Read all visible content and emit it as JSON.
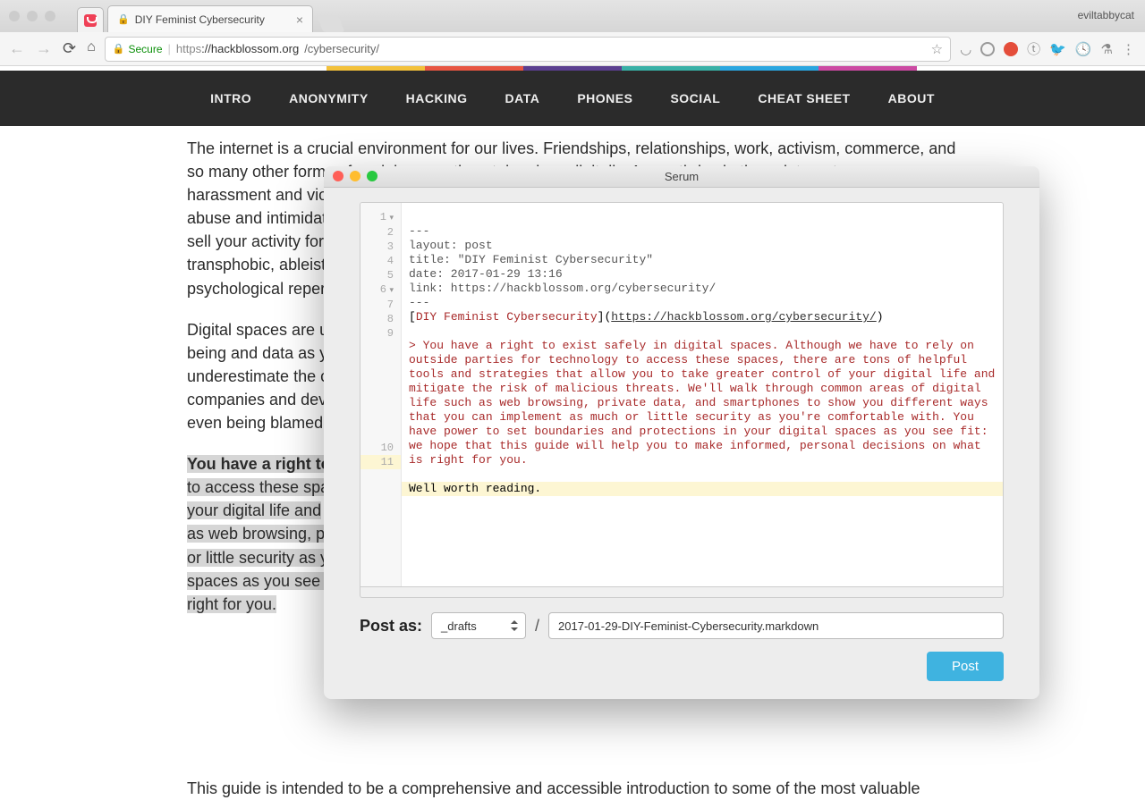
{
  "browser": {
    "profile": "eviltabbycat",
    "tab_title": "DIY Feminist Cybersecurity",
    "secure_label": "Secure",
    "url_scheme": "https",
    "url_host": "://hackblossom.org",
    "url_path": "/cybersecurity/"
  },
  "nav": {
    "items": [
      "INTRO",
      "ANONYMITY",
      "HACKING",
      "DATA",
      "PHONES",
      "SOCIAL",
      "CHEAT SHEET",
      "ABOUT"
    ]
  },
  "page": {
    "p1": "The internet is a crucial environment for our lives. Friendships, relationships, work, activism, commerce, and so many other forms of social connections take place digitally. As we thrive in these internet spaces, harassment and violence along",
    "p1b": "abuse and intimidat",
    "p1c": "sell your activity for",
    "p1d": "transphobic, ableist",
    "p1e": "psychological reper",
    "p2": "Digital spaces are u",
    "p2b": "being and data as y",
    "p2c": "underestimate the c",
    "p2d": "companies and dev",
    "p2e": "even being blamed",
    "p3_lead": "You have a right to",
    "p3a": "to access these spa",
    "p3b": "your digital life and",
    "p3c": "as web browsing, pr",
    "p3d": "or little security as y",
    "p3e": "spaces as you see f",
    "p3f": "right for you.",
    "p4": "This guide is intended to be a comprehensive and accessible introduction to some of the most valuable"
  },
  "editor": {
    "title": "Serum",
    "post_as_label": "Post as:",
    "folder_selected": "_drafts",
    "filename": "2017-01-29-DIY-Feminist-Cybersecurity.markdown",
    "post_button": "Post",
    "lines": {
      "l1": "---",
      "l2": "layout: post",
      "l3": "title: \"DIY Feminist Cybersecurity\"",
      "l4": "date: 2017-01-29 13:16",
      "l5": "link: https://hackblossom.org/cybersecurity/",
      "l6": "---",
      "l7_open": "[",
      "l7_text": "DIY Feminist Cybersecurity",
      "l7_mid": "](",
      "l7_url": "https://hackblossom.org/cybersecurity/",
      "l7_close": ")",
      "l9": "> You have a right to exist safely in digital spaces. Although we have to rely on outside parties for technology to access these spaces, there are tons of helpful tools and strategies that allow you to take greater control of your digital life and mitigate the risk of malicious threats. We'll walk through common areas of digital life such as web browsing, private data, and smartphones to show you different ways that you can implement as much or little security as you're comfortable with. You have power to set boundaries and protections in your digital spaces as you see fit: we hope that this guide will help you to make informed, personal decisions on what is right for you.",
      "l11": "Well worth reading."
    },
    "gutter": [
      "1",
      "2",
      "3",
      "4",
      "5",
      "6",
      "7",
      "8",
      "9",
      "10",
      "11"
    ]
  }
}
